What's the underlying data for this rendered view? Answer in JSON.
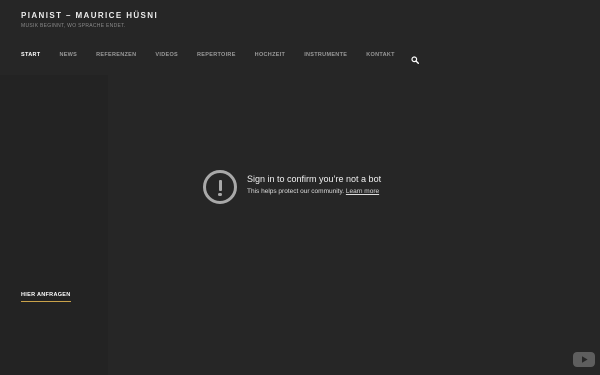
{
  "site": {
    "title": "PIANIST – MAURICE HÜSNI",
    "tagline": "MUSIK BEGINNT, WO SPRACHE ENDET."
  },
  "nav": {
    "items": [
      {
        "label": "START",
        "active": true
      },
      {
        "label": "NEWS"
      },
      {
        "label": "REFERENZEN"
      },
      {
        "label": "VIDEOS"
      },
      {
        "label": "REPERTOIRE"
      },
      {
        "label": "HOCHZEIT"
      },
      {
        "label": "INSTRUMENTE"
      },
      {
        "label": "KONTAKT"
      }
    ],
    "search_icon": "search-icon"
  },
  "video": {
    "error_title": "Sign in to confirm you’re not a bot",
    "error_message": "This helps protect our community.",
    "learn_more": "Learn more",
    "error_icon": "exclamation-circle-icon",
    "player_logo_icon": "youtube-icon"
  },
  "cta": {
    "label": "HIER ANFRAGEN"
  },
  "colors": {
    "background": "#262626",
    "nav_active": "#ffffff",
    "nav_inactive": "#9a9a9a",
    "cta_underline": "#c9a24a"
  }
}
